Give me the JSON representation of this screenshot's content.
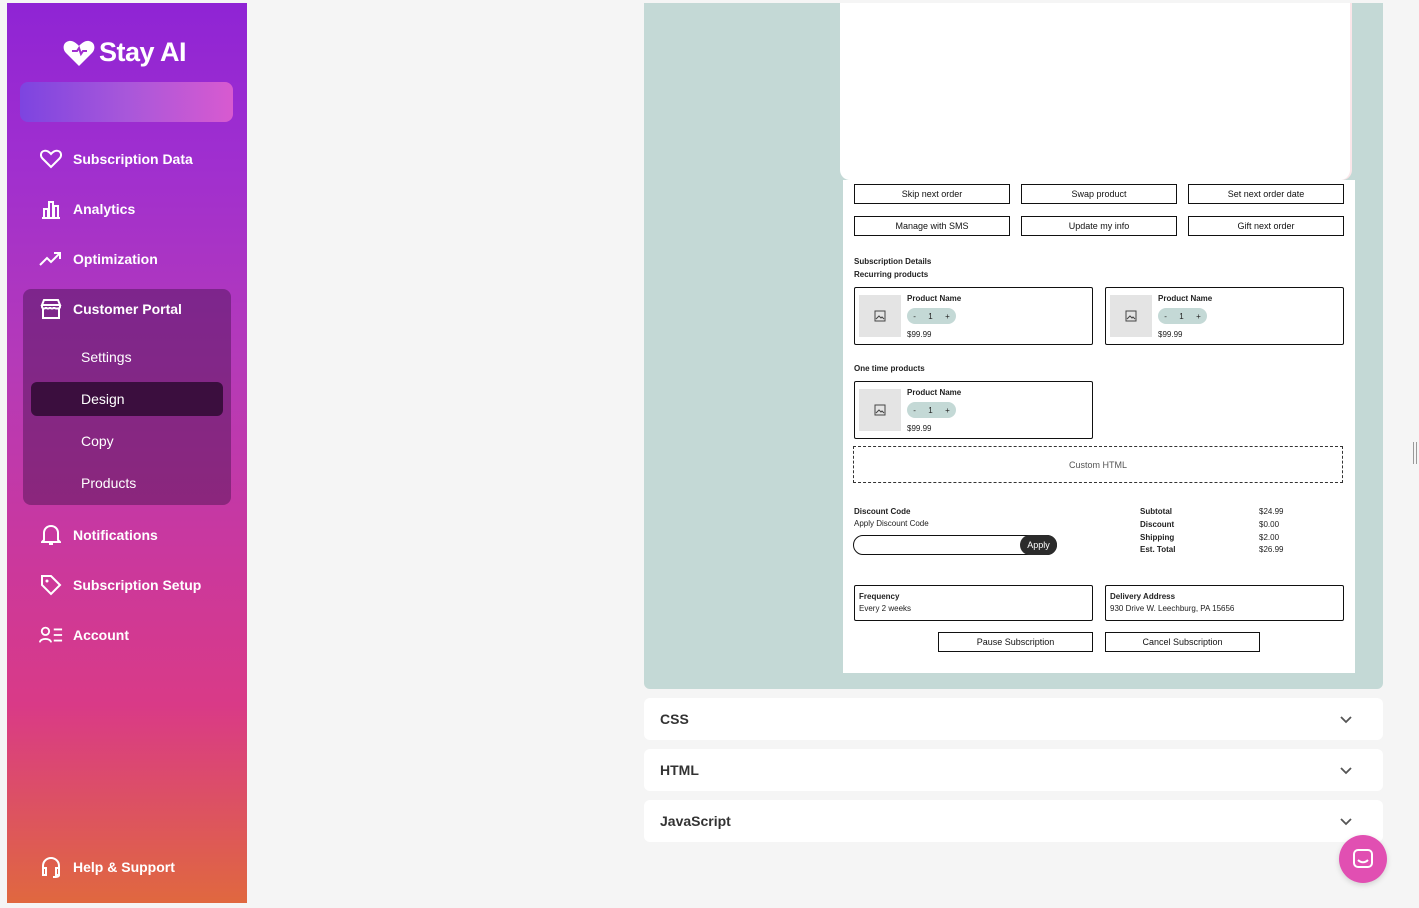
{
  "brand": {
    "name": "Stay AI"
  },
  "sidebar": {
    "items": [
      {
        "label": "Subscription Data",
        "icon": "heart-icon"
      },
      {
        "label": "Analytics",
        "icon": "bar-chart-icon"
      },
      {
        "label": "Optimization",
        "icon": "trending-up-icon"
      },
      {
        "label": "Customer Portal",
        "icon": "storefront-icon"
      },
      {
        "label": "Notifications",
        "icon": "bell-icon"
      },
      {
        "label": "Subscription Setup",
        "icon": "tag-icon"
      },
      {
        "label": "Account",
        "icon": "user-list-icon"
      }
    ],
    "portal_subitems": [
      "Settings",
      "Design",
      "Copy",
      "Products"
    ],
    "active_subitem": "Design",
    "help": {
      "label": "Help & Support",
      "icon": "headset-icon"
    }
  },
  "preview": {
    "actions": [
      "Skip next order",
      "Swap product",
      "Set next order date",
      "Manage with SMS",
      "Update my info",
      "Gift next order"
    ],
    "subscription_details_label": "Subscription Details",
    "recurring_label": "Recurring products",
    "one_time_label": "One time products",
    "product": {
      "name": "Product Name",
      "minus": "-",
      "qty": "1",
      "plus": "+",
      "price": "$99.99"
    },
    "custom_html_label": "Custom HTML",
    "discount": {
      "title": "Discount Code",
      "subtitle": "Apply Discount Code",
      "button": "Apply"
    },
    "totals": [
      {
        "label": "Subtotal",
        "value": "$24.99"
      },
      {
        "label": "Discount",
        "value": "$0.00"
      },
      {
        "label": "Shipping",
        "value": "$2.00"
      },
      {
        "label": "Est. Total",
        "value": "$26.99"
      }
    ],
    "frequency": {
      "title": "Frequency",
      "value": "Every 2 weeks"
    },
    "delivery": {
      "title": "Delivery Address",
      "value": "930 Drive W. Leechburg, PA 15656"
    },
    "pause_label": "Pause Subscription",
    "cancel_label": "Cancel Subscription"
  },
  "accordions": [
    "CSS",
    "HTML",
    "JavaScript"
  ],
  "colors": {
    "accent_teal": "#c4d9d6",
    "chat_button": "#e14fb2"
  }
}
